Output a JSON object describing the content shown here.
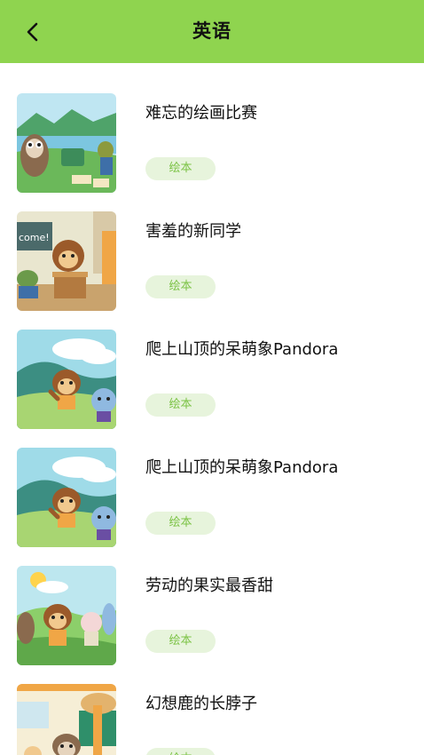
{
  "header": {
    "title": "英语",
    "back_icon": "chevron-left-icon",
    "background_color": "#8fd44f"
  },
  "items": [
    {
      "title": "难忘的绘画比赛",
      "tag": "绘本"
    },
    {
      "title": "害羞的新同学",
      "tag": "绘本"
    },
    {
      "title": "爬上山顶的呆萌象Pandora",
      "tag": "绘本"
    },
    {
      "title": "爬上山顶的呆萌象Pandora",
      "tag": "绘本"
    },
    {
      "title": "劳动的果实最香甜",
      "tag": "绘本"
    },
    {
      "title": "幻想鹿的长脖子",
      "tag": "绘本"
    }
  ],
  "thumbnails": {
    "classroom_board_text": "come!"
  },
  "colors": {
    "tag_background": "#e7f4dc",
    "tag_text": "#7cc346"
  }
}
